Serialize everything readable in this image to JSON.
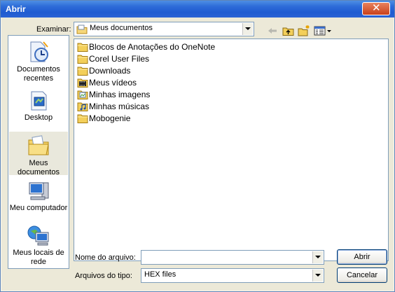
{
  "window": {
    "title": "Abrir",
    "close_glyph": "✕"
  },
  "lookin": {
    "label": "Examinar:",
    "value": "Meus documentos"
  },
  "places": [
    {
      "label": "Documentos recentes",
      "icon": "recent-documents-icon"
    },
    {
      "label": "Desktop",
      "icon": "desktop-icon"
    },
    {
      "label": "Meus documentos",
      "icon": "my-documents-icon",
      "selected": true
    },
    {
      "label": "Meu computador",
      "icon": "my-computer-icon"
    },
    {
      "label": "Meus locais de rede",
      "icon": "network-places-icon"
    }
  ],
  "files": [
    {
      "name": "Blocos de Anotações do OneNote",
      "icon": "folder-icon"
    },
    {
      "name": "Corel User Files",
      "icon": "folder-icon"
    },
    {
      "name": "Downloads",
      "icon": "folder-icon"
    },
    {
      "name": "Meus vídeos",
      "icon": "video-folder-icon"
    },
    {
      "name": "Minhas imagens",
      "icon": "pictures-folder-icon"
    },
    {
      "name": "Minhas músicas",
      "icon": "music-folder-icon"
    },
    {
      "name": "Mobogenie",
      "icon": "folder-icon"
    }
  ],
  "filename": {
    "label": "Nome do arquivo:",
    "value": ""
  },
  "filetype": {
    "label": "Arquivos do tipo:",
    "value": "HEX files"
  },
  "buttons": {
    "open": "Abrir",
    "cancel": "Cancelar"
  },
  "colors": {
    "titlebar": "#2d6bd8",
    "selection": "#e9e8dc",
    "border": "#7f9db9"
  }
}
